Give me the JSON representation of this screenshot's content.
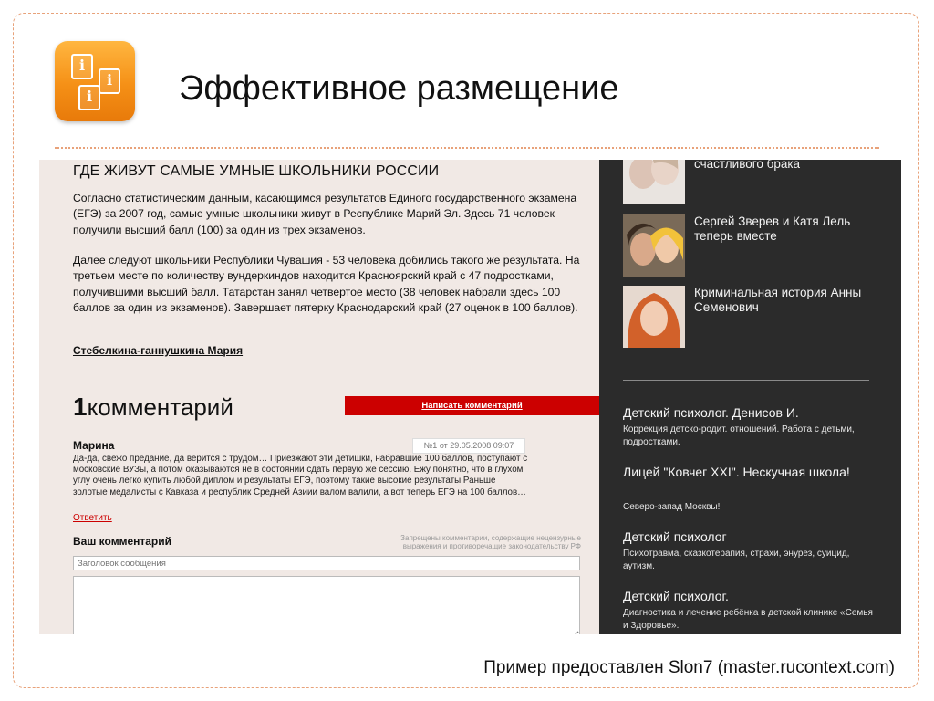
{
  "slide": {
    "title": "Эффективное размещение",
    "credit": "Пример предоставлен Slon7 (master.rucontext.com)",
    "icon": "info-icon",
    "accent_color": "#f59016"
  },
  "article": {
    "title": "ГДЕ ЖИВУТ САМЫЕ УМНЫЕ ШКОЛЬНИКИ РОССИИ",
    "paragraph1": "Согласно статистическим данным, касающимся результатов Единого государственного экзамена (ЕГЭ) за 2007 год, самые умные школьники живут в Республике Марий Эл. Здесь 71 человек получили высший балл (100) за один из трех экзаменов.",
    "paragraph2": "Далее следуют школьники Республики Чувашия - 53 человека добились такого же результата. На третьем месте по количеству вундеркиндов находится Красноярский край с 47 подростками, получившими высший балл. Татарстан занял четвертое место (38 человек набрали здесь 100 баллов за один из экзаменов). Завершает пятерку Краснодарский край (27 оценок в 100 баллов).",
    "author": "Стебелкина-ганнушкина Мария"
  },
  "comments": {
    "count": "1",
    "label": "комментарий",
    "write_button": "Написать комментарий",
    "items": [
      {
        "author": "Марина",
        "meta": "№1 от 29.05.2008 09:07",
        "text": "Да-да, свежо предание, да верится с трудом… Приезжают эти детишки, набравшие 100 баллов, поступают с московские ВУЗы, а потом оказываются не в состоянии сдать первую же сессию. Ежу понятно, что в глухом углу очень легко купить любой диплом и результаты ЕГЭ, поэтому такие высокие результаты.Раньше золотые медалисты с Кавказа и республик Средней Азиии валом валили, а вот теперь ЕГЭ на 100 баллов…",
        "reply": "Ответить"
      }
    ],
    "form": {
      "heading": "Ваш комментарий",
      "rules": "Запрещены комментарии, содержащие нецензурные выражения и противоречащие законодательству РФ",
      "subject_placeholder": "Заголовок сообщения"
    }
  },
  "sidebar": {
    "news": [
      {
        "caption": "счастливого брака",
        "thumb": "couple-photo"
      },
      {
        "caption": "Сергей Зверев и Катя Лель теперь вместе",
        "thumb": "celebrity-couple-photo"
      },
      {
        "caption": "Криминальная история Анны Семенович",
        "thumb": "redhead-woman-photo"
      }
    ],
    "ads": [
      {
        "title": "Детский психолог. Денисов И.",
        "desc": "Коррекция детско-родит. отношений. Работа с детьми, подростками."
      },
      {
        "title": "Лицей \"Ковчег XXI\". Нескучная школа!",
        "desc": "Северо-запад Москвы!"
      },
      {
        "title": "Детский психолог",
        "desc": "Психотравма, сказкотерапия, страхи, энурез, суицид, аутизм."
      },
      {
        "title": "Детский психолог.",
        "desc": "Диагностика и лечение ребёнка в детской клинике «Семья и Здоровье»."
      }
    ]
  }
}
